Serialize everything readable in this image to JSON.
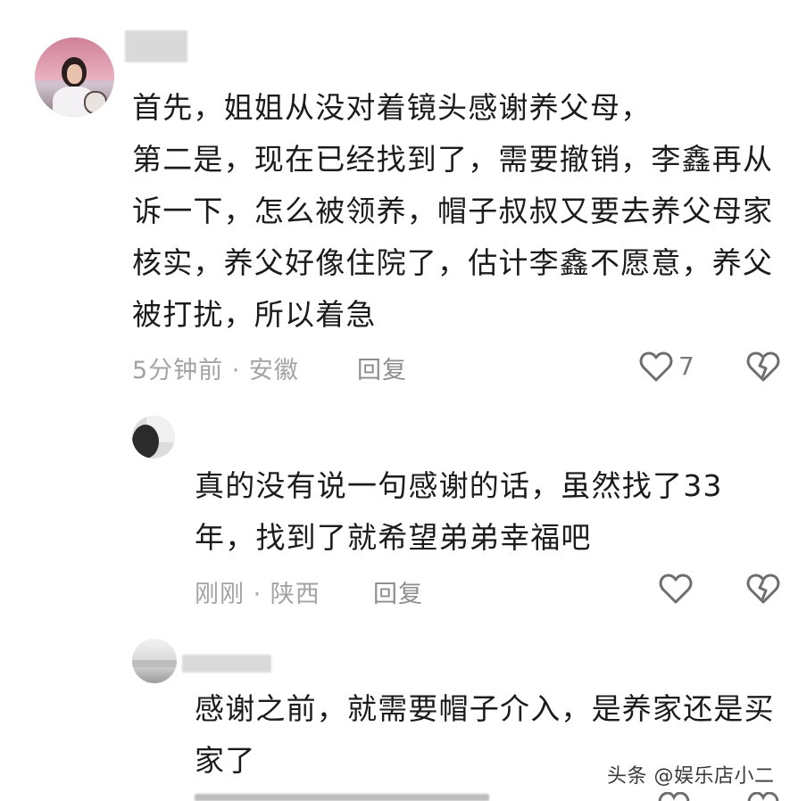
{
  "comments": [
    {
      "text": "首先，姐姐从没对着镜头感谢养父母，\n第二是，现在已经找到了，需要撤销，李鑫再从诉一下，怎么被领养，帽子叔叔又要去养父母家核实，养父好像住院了，估计李鑫不愿意，养父被打扰，所以着急",
      "meta": "5分钟前 · 安徽",
      "reply_label": "回复",
      "like_count": "7"
    },
    {
      "text": "真的没有说一句感谢的话，虽然找了33年，找到了就希望弟弟幸福吧",
      "meta": "刚刚 · 陕西",
      "reply_label": "回复"
    },
    {
      "text": "感谢之前，就需要帽子介入，是养家还是买家了"
    }
  ],
  "watermark": "头条 @娱乐店小二",
  "icons": {
    "like": "heart-outline-icon",
    "dislike": "broken-heart-icon"
  }
}
